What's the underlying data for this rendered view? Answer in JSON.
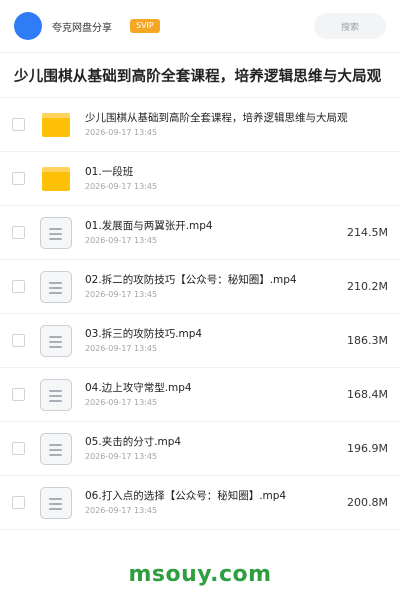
{
  "header": {
    "brand": "夸克网盘分享",
    "badge": "SVIP",
    "search_placeholder": "搜索"
  },
  "title": "少儿围棋从基础到高阶全套课程，培养逻辑思维与大局观",
  "items": [
    {
      "type": "folder",
      "name": "少儿围棋从基础到高阶全套课程，培养逻辑思维与大局观",
      "date": "2026-09-17 13:45",
      "size": ""
    },
    {
      "type": "folder",
      "name": "01.一段班",
      "date": "2026-09-17 13:45",
      "size": ""
    },
    {
      "type": "file",
      "name": "01.发展面与两翼张开.mp4",
      "date": "2026-09-17 13:45",
      "size": "214.5M"
    },
    {
      "type": "file",
      "name": "02.拆二的攻防技巧【公众号：秘知圈】.mp4",
      "date": "2026-09-17 13:45",
      "size": "210.2M"
    },
    {
      "type": "file",
      "name": "03.拆三的攻防技巧.mp4",
      "date": "2026-09-17 13:45",
      "size": "186.3M"
    },
    {
      "type": "file",
      "name": "04.边上攻守常型.mp4",
      "date": "2026-09-17 13:45",
      "size": "168.4M"
    },
    {
      "type": "file",
      "name": "05.夹击的分寸.mp4",
      "date": "2026-09-17 13:45",
      "size": "196.9M"
    },
    {
      "type": "file",
      "name": "06.打入点的选择【公众号：秘知圈】.mp4",
      "date": "2026-09-17 13:45",
      "size": "200.8M"
    }
  ],
  "watermark": "msouy.com",
  "colors": {
    "accent": "#2f7cf6",
    "svip": "#f5a623",
    "folder": "#ffc107",
    "watermark": "#2e9e3f"
  }
}
